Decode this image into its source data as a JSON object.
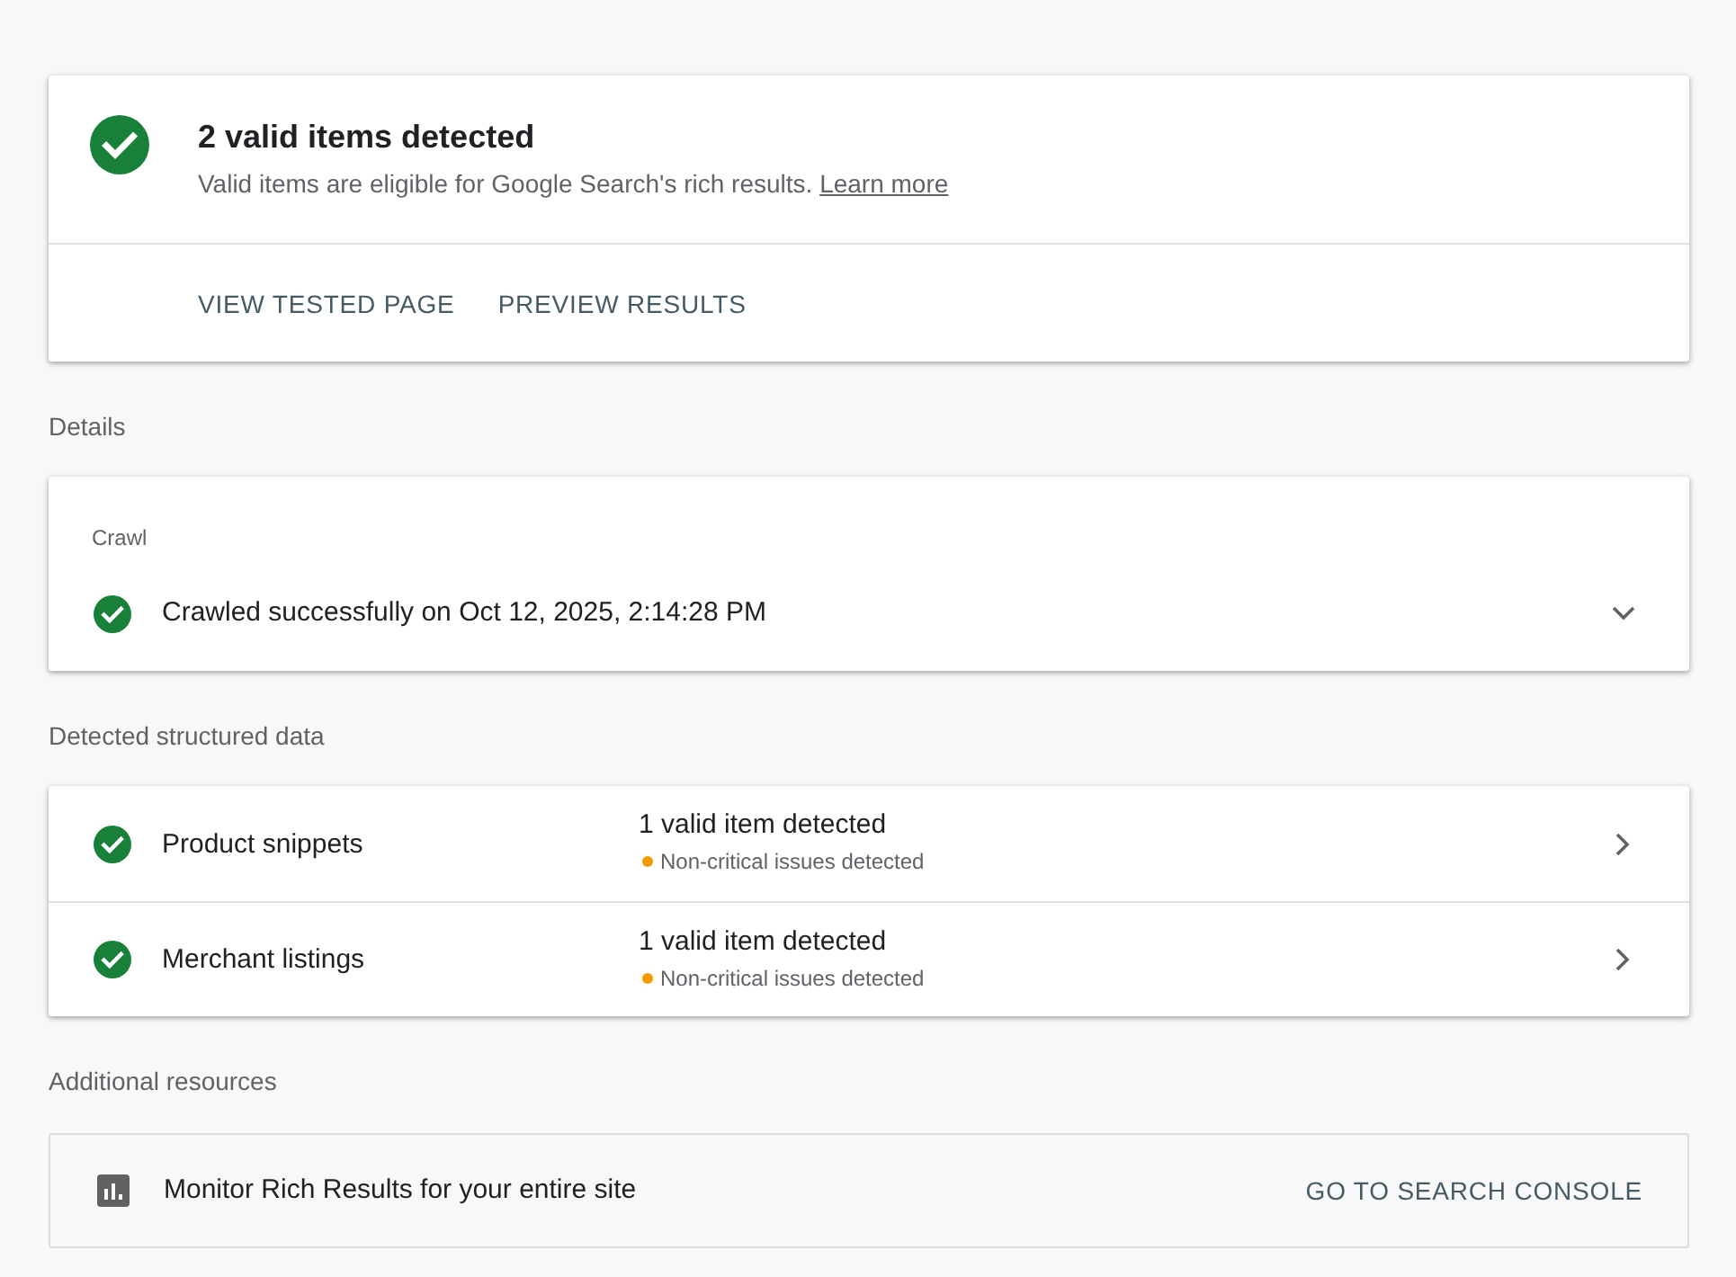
{
  "summary": {
    "valid": true,
    "title": "2 valid items detected",
    "description": "Valid items are eligible for Google Search's rich results.",
    "link": "Learn more",
    "actions": [
      "VIEW TESTED PAGE",
      "PREVIEW RESULTS"
    ]
  },
  "details": {
    "heading": "Details",
    "crawl": {
      "label": "Crawl",
      "valid": true,
      "message": "Crawled successfully on Oct 12, 2025, 2:14:28 PM",
      "expanded": false
    }
  },
  "structured_data": {
    "heading": "Detected structured data",
    "items": [
      {
        "valid": true,
        "name": "Product snippets",
        "result": "1 valid item detected",
        "note": {
          "text": "Non-critical issues detected",
          "color": "#f29900"
        }
      },
      {
        "valid": true,
        "name": "Merchant listings",
        "result": "1 valid item detected",
        "note": {
          "text": "Non-critical issues detected",
          "color": "#f29900"
        }
      }
    ]
  },
  "resources": {
    "heading": "Additional resources",
    "text": "Monitor Rich Results for your entire site",
    "action": "GO TO SEARCH CONSOLE"
  }
}
